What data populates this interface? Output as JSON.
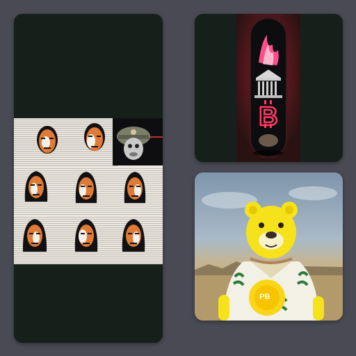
{
  "gallery": {
    "background_color": "#4a4a54",
    "card_color": "#16201b",
    "items": [
      {
        "id": "left",
        "icon": "collage-faces"
      },
      {
        "id": "top-right",
        "icon": "skateboard-bitcoin"
      },
      {
        "id": "bottom-right",
        "icon": "yellow-bear",
        "badge_text": "PB"
      }
    ]
  }
}
